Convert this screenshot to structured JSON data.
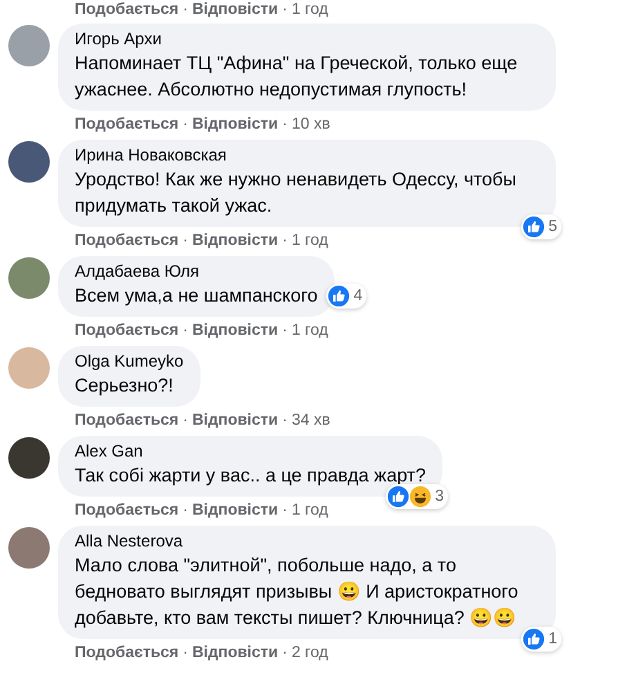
{
  "top_actions": {
    "like_label": "Подобається",
    "separator_1": "·",
    "reply_label": "Відповісти",
    "separator_2": "·",
    "time": "1 год"
  },
  "comments": [
    {
      "author": "Игорь Архи",
      "text": "Напоминает ТЦ \"Афина\" на Греческой, только еще ужаснее. Абсолютно недопустимая глупость!",
      "like_label": "Подобається",
      "separator_1": "·",
      "reply_label": "Відповісти",
      "separator_2": "·",
      "time": "10 хв"
    },
    {
      "author": "Ирина Новаковская",
      "text": "Уродство! Как же нужно ненавидеть Одессу, чтобы придумать такой ужас.",
      "reactions": {
        "beside_bubble": false,
        "icons": [
          {
            "kind": "like"
          }
        ],
        "count": "5"
      },
      "like_label": "Подобається",
      "separator_1": "·",
      "reply_label": "Відповісти",
      "separator_2": "·",
      "time": "1 год"
    },
    {
      "author": "Алдабаева Юля",
      "text": "Всем ума,а не шампанского",
      "reactions": {
        "beside_bubble": true,
        "icons": [
          {
            "kind": "like"
          }
        ],
        "count": "4"
      },
      "like_label": "Подобається",
      "separator_1": "·",
      "reply_label": "Відповісти",
      "separator_2": "·",
      "time": "1 год"
    },
    {
      "author": "Olga Kumeyko",
      "text": "Серьезно?!",
      "like_label": "Подобається",
      "separator_1": "·",
      "reply_label": "Відповісти",
      "separator_2": "·",
      "time": "34 хв"
    },
    {
      "author": "Alex Gan",
      "text": "Так собі жарти у вас.. а це правда жарт?",
      "reactions": {
        "beside_bubble": false,
        "icons": [
          {
            "kind": "like"
          },
          {
            "kind": "haha"
          }
        ],
        "count": "3"
      },
      "like_label": "Подобається",
      "separator_1": "·",
      "reply_label": "Відповісти",
      "separator_2": "·",
      "time": "1 год"
    },
    {
      "author": "Alla Nesterova",
      "text": "Мало слова \"элитной\", побольше надо, а то бедновато выглядят призывы 😀 И аристократного добавьте, кто вам тексты пишет? Ключница? 😀😀",
      "reactions": {
        "beside_bubble": false,
        "icons": [
          {
            "kind": "like"
          }
        ],
        "count": "1"
      },
      "like_label": "Подобається",
      "separator_1": "·",
      "reply_label": "Відповісти",
      "separator_2": "·",
      "time": "2 год"
    }
  ]
}
